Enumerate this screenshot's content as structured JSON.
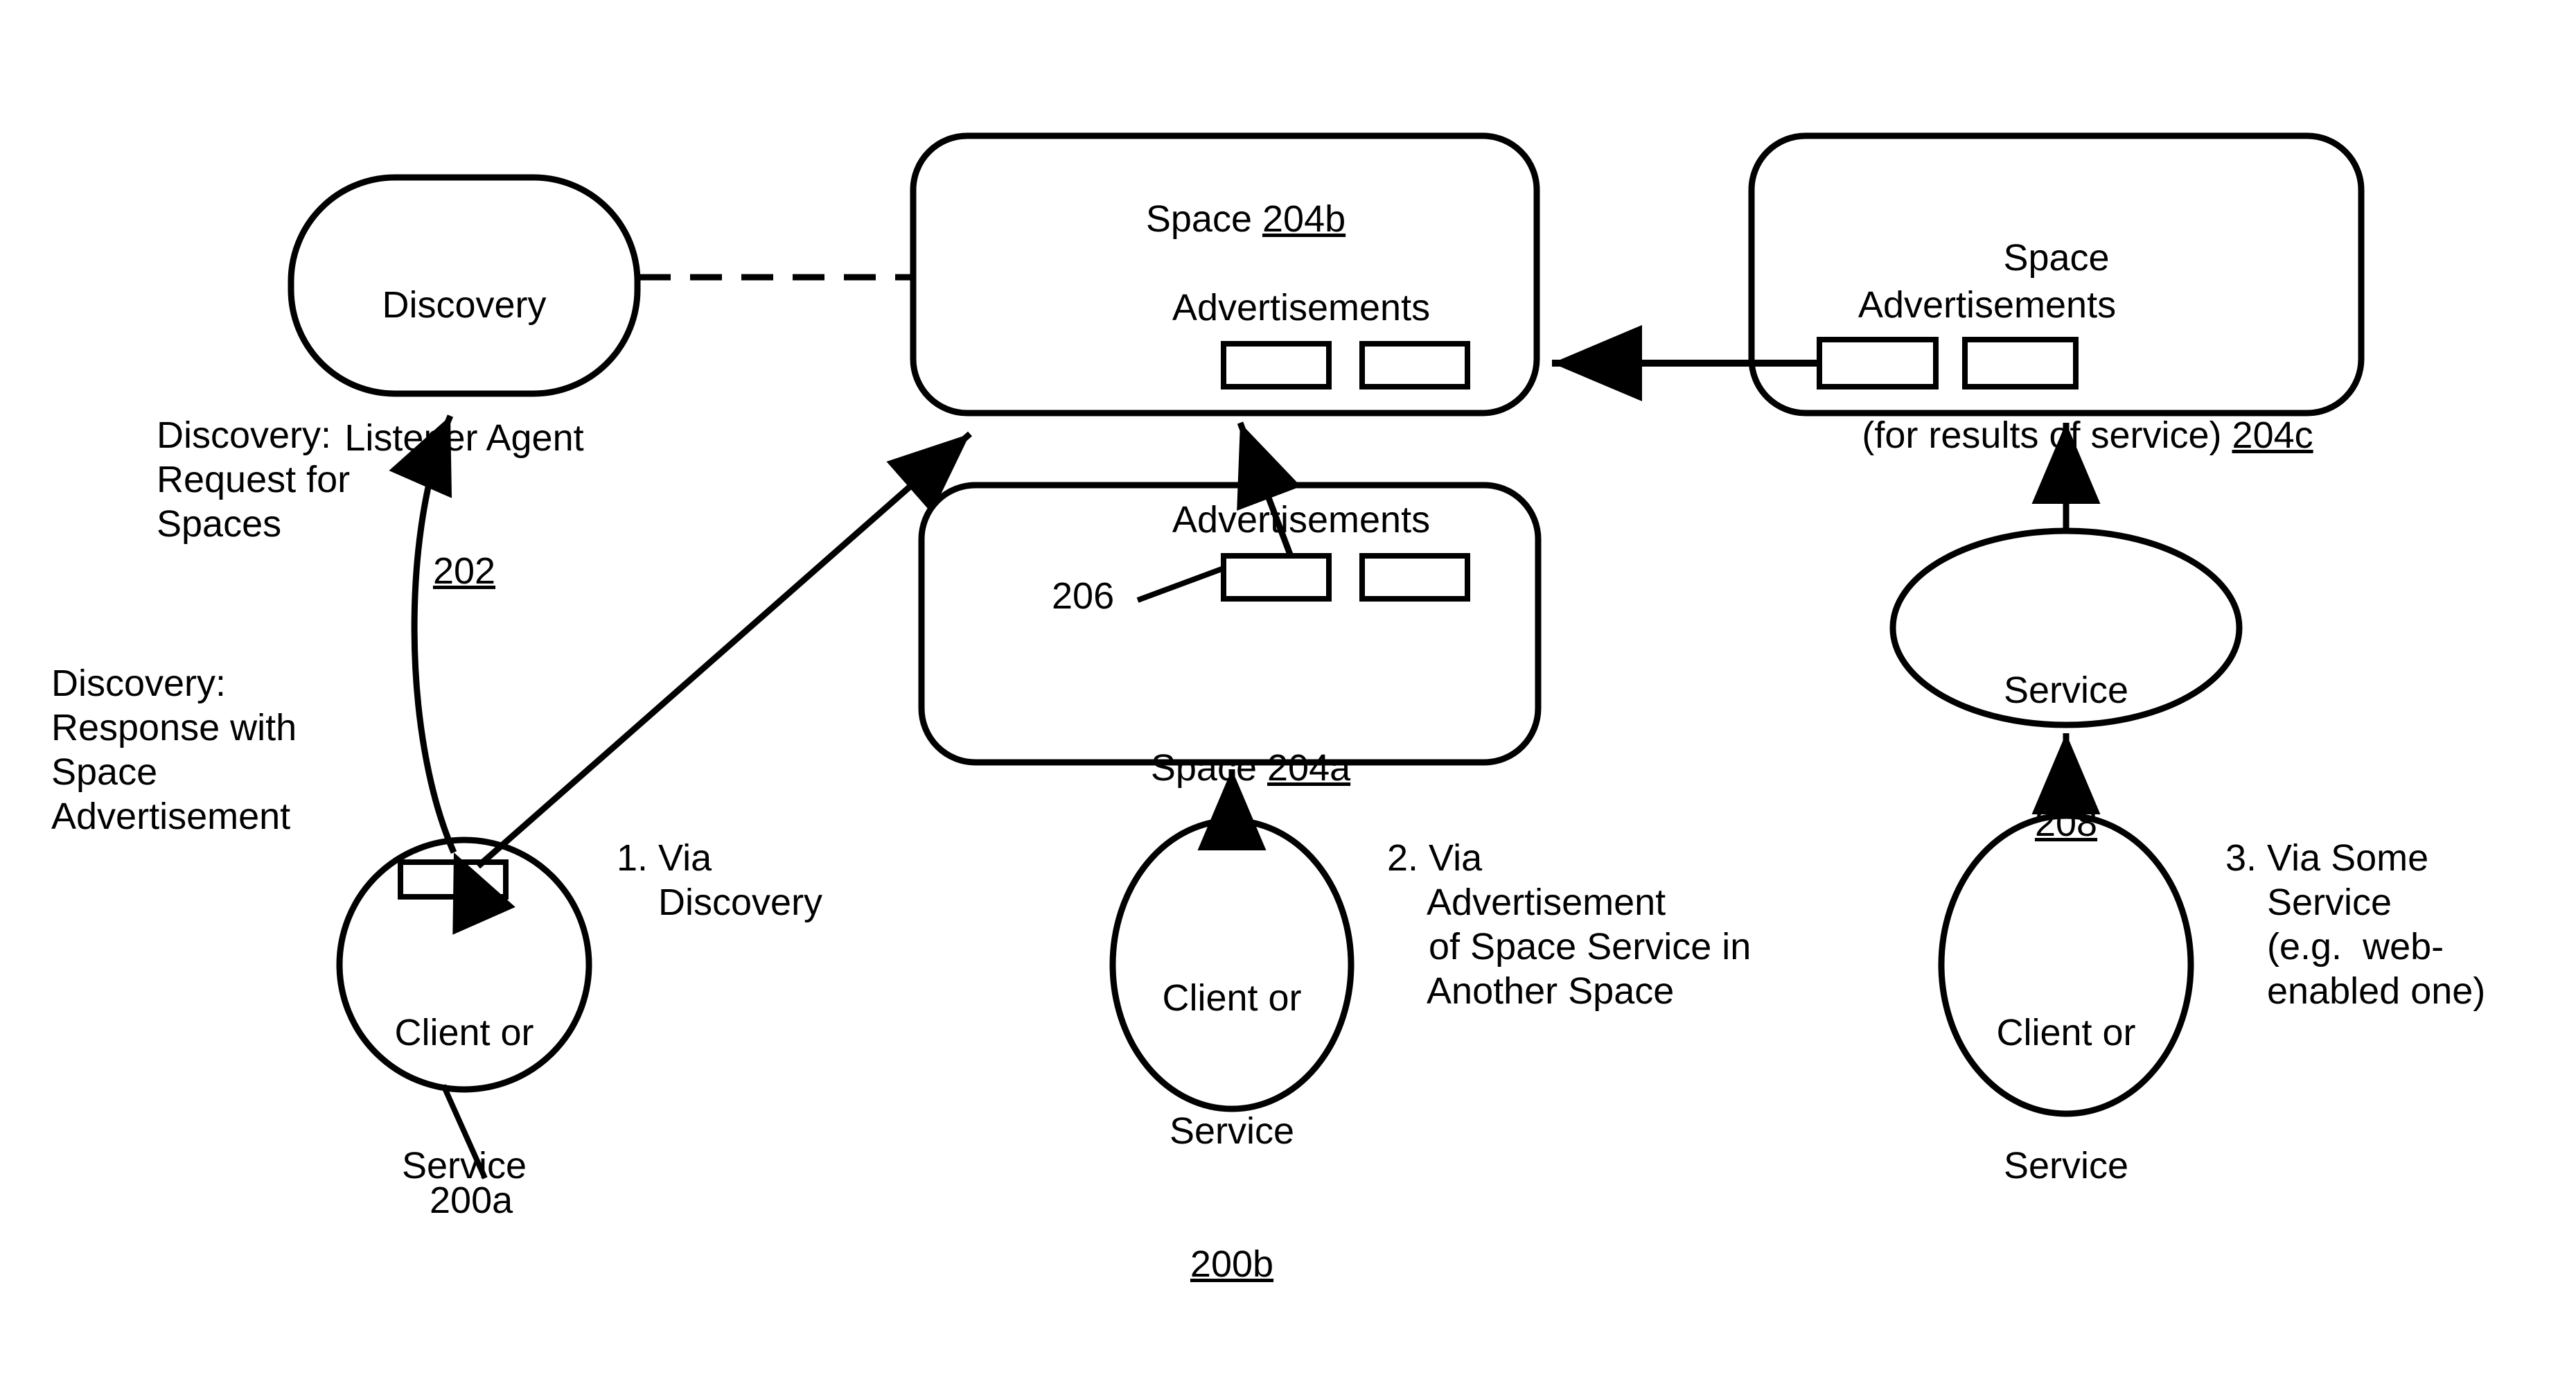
{
  "figure": {
    "type": "patent-diagram",
    "description": "Three ways a client or service locates a Space: via Discovery, via Advertisement of Space Service in Another Space, and via Some Service."
  },
  "nodes": {
    "discovery_listener_agent": {
      "line1": "Discovery",
      "line2": "Listener Agent",
      "ref": "202"
    },
    "space_204b": {
      "title": "Space",
      "ref": "204b",
      "advertisements_label": "Advertisements"
    },
    "space_204a": {
      "title": "Space",
      "ref": "204a",
      "advertisements_label": "Advertisements",
      "ad_callout": "206"
    },
    "space_204c": {
      "title_line1": "Space",
      "title_line2": "(for results of service)",
      "ref": "204c",
      "advertisements_label": "Advertisements"
    },
    "client_or_service_200a": {
      "line1": "Client or",
      "line2": "Service",
      "ref": "200a"
    },
    "client_or_service_200b": {
      "line1": "Client or",
      "line2": "Service",
      "ref": "200b"
    },
    "client_or_service_right": {
      "line1": "Client or",
      "line2": "Service"
    },
    "service_208": {
      "title": "Service",
      "ref": "208"
    }
  },
  "annotations": {
    "discovery_request": "Discovery:\nRequest for\nSpaces",
    "discovery_response": "Discovery:\nResponse with\nSpace\nAdvertisement",
    "path_1": "1. Via\n    Discovery",
    "path_2": "2. Via\n    Advertisement\n    of Space Service in\n    Another Space",
    "path_3": "3. Via Some\n    Service\n    (e.g.  web-\n    enabled one)"
  },
  "style": {
    "stroke": "#000000",
    "background": "#ffffff"
  }
}
